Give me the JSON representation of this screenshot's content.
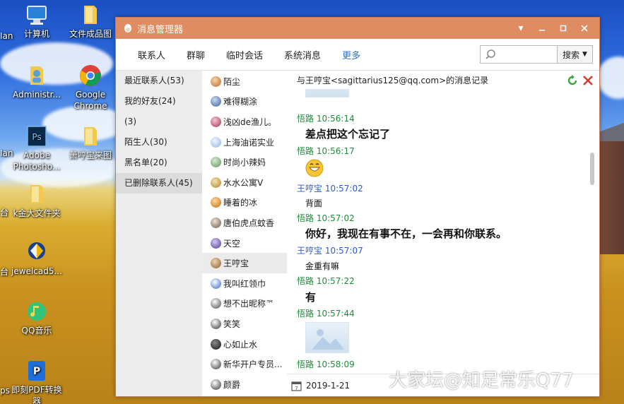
{
  "desktop": {
    "icons": [
      {
        "label": "计算机"
      },
      {
        "label": "文件成品图"
      },
      {
        "label": "Administr..."
      },
      {
        "label": "Google Chrome"
      },
      {
        "label": "Adobe Photosho..."
      },
      {
        "label": "萧哼宝来图"
      },
      {
        "label": "k金大文件夹"
      },
      {
        "label": "jewelcad5..."
      },
      {
        "label": "QQ音乐"
      },
      {
        "label": "即刻PDF转换器"
      }
    ],
    "cut_labels": [
      "Ian",
      "台",
      "台",
      "ps"
    ]
  },
  "window": {
    "title": "消息管理器",
    "controls": {
      "dropdown": "▾",
      "minimize": "▭",
      "maximize": "□",
      "close": "✕"
    }
  },
  "nav": {
    "tabs": [
      "联系人",
      "群聊",
      "临时会话",
      "系统消息",
      "更多"
    ],
    "search_placeholder": "",
    "search_button": "搜索"
  },
  "groups": [
    "最近联系人(53)",
    "我的好友(24)",
    "(3)",
    "陌生人(30)",
    "黑名单(20)",
    "已删除联系人(45)"
  ],
  "contacts": [
    "陌尘",
    "难得糊涂",
    "浅凶de渔儿。",
    "上海油诺实业",
    "时尚小辣妈",
    "水水公寓V",
    "睡着的冰",
    "唐伯虎点蚊香",
    "天空",
    "王哼宝",
    "我叫红领巾",
    "想不出昵称™",
    "笑笑",
    "心如止水",
    "新华开户专员...",
    "颜爵"
  ],
  "chat": {
    "header": "与王哼宝<sagittarius125@qq.com>的消息记录",
    "messages": [
      {
        "sender": "悟路",
        "time": "10:56:14",
        "text": "差点把这个忘记了"
      },
      {
        "sender": "悟路",
        "time": "10:56:17",
        "text": ""
      },
      {
        "sender": "王哼宝",
        "time": "10:57:02",
        "text": "背面"
      },
      {
        "sender": "悟路",
        "time": "10:57:02",
        "text": "你好，我现在有事不在，一会再和你联系。"
      },
      {
        "sender": "王哼宝",
        "time": "10:57:07",
        "text": "金重有嘛"
      },
      {
        "sender": "悟路",
        "time": "10:57:22",
        "text": "有"
      },
      {
        "sender": "悟路",
        "time": "10:57:44",
        "text": ""
      },
      {
        "sender": "悟路",
        "time": "10:58:09",
        "text": ""
      }
    ],
    "footer_date": "2019-1-21"
  },
  "watermark": "大家坛@知足常乐Q77",
  "colors": {
    "titlebar": "#e08c62",
    "me": "#1f8c3b",
    "other": "#2a5cc8",
    "nav_more": "#2a6fc9"
  }
}
